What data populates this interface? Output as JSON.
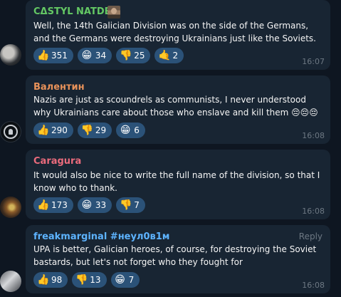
{
  "comments": [
    {
      "author": "CΔSTYL NATDEM",
      "text": "Well, the 14th Galician Division was on the side of the Germans, and the Germans were destroying Ukrainians just like the Soviets.",
      "time": "16:07",
      "reactions": [
        {
          "emoji": "👍",
          "icon": "thumbs-up-icon",
          "count": "351"
        },
        {
          "emoji": "😁",
          "icon": "grin-icon",
          "count": "34"
        },
        {
          "emoji": "👎",
          "icon": "thumbs-down-icon",
          "count": "25"
        },
        {
          "emoji": "🤙",
          "icon": "call-me-hand-icon",
          "count": "2"
        }
      ]
    },
    {
      "author": "Валентин",
      "text": "Nazis are just as scoundrels as communists, I never understood why Ukrainians care about those who enslave and kill them 😔😔😔",
      "time": "16:08",
      "reactions": [
        {
          "emoji": "👍",
          "icon": "thumbs-up-icon",
          "count": "290"
        },
        {
          "emoji": "👎",
          "icon": "thumbs-down-icon",
          "count": "29"
        },
        {
          "emoji": "😁",
          "icon": "grin-icon",
          "count": "6"
        }
      ]
    },
    {
      "author": "Caragura",
      "text": "It would also be nice to write the full name of the division, so that I know who to thank.",
      "time": "16:08",
      "reactions": [
        {
          "emoji": "👍",
          "icon": "thumbs-up-icon",
          "count": "173"
        },
        {
          "emoji": "😁",
          "icon": "grin-icon",
          "count": "33"
        },
        {
          "emoji": "👎",
          "icon": "thumbs-down-icon",
          "count": "7"
        }
      ]
    },
    {
      "author": "freakmarginal #неул0в1м",
      "reply_label": "Reply",
      "text": "UPA is better, Galician heroes, of course, for destroying the Soviet bastards, but let's not forget who they fought for",
      "time": "16:08",
      "reactions": [
        {
          "emoji": "👍",
          "icon": "thumbs-up-icon",
          "count": "98"
        },
        {
          "emoji": "👎",
          "icon": "thumbs-down-icon",
          "count": "13"
        },
        {
          "emoji": "😁",
          "icon": "grin-icon",
          "count": "7"
        }
      ]
    }
  ],
  "colors": {
    "background": "#0e1621",
    "bubble": "#182533",
    "reaction_chip": "#2b5278",
    "timestamp": "#6d7883"
  }
}
